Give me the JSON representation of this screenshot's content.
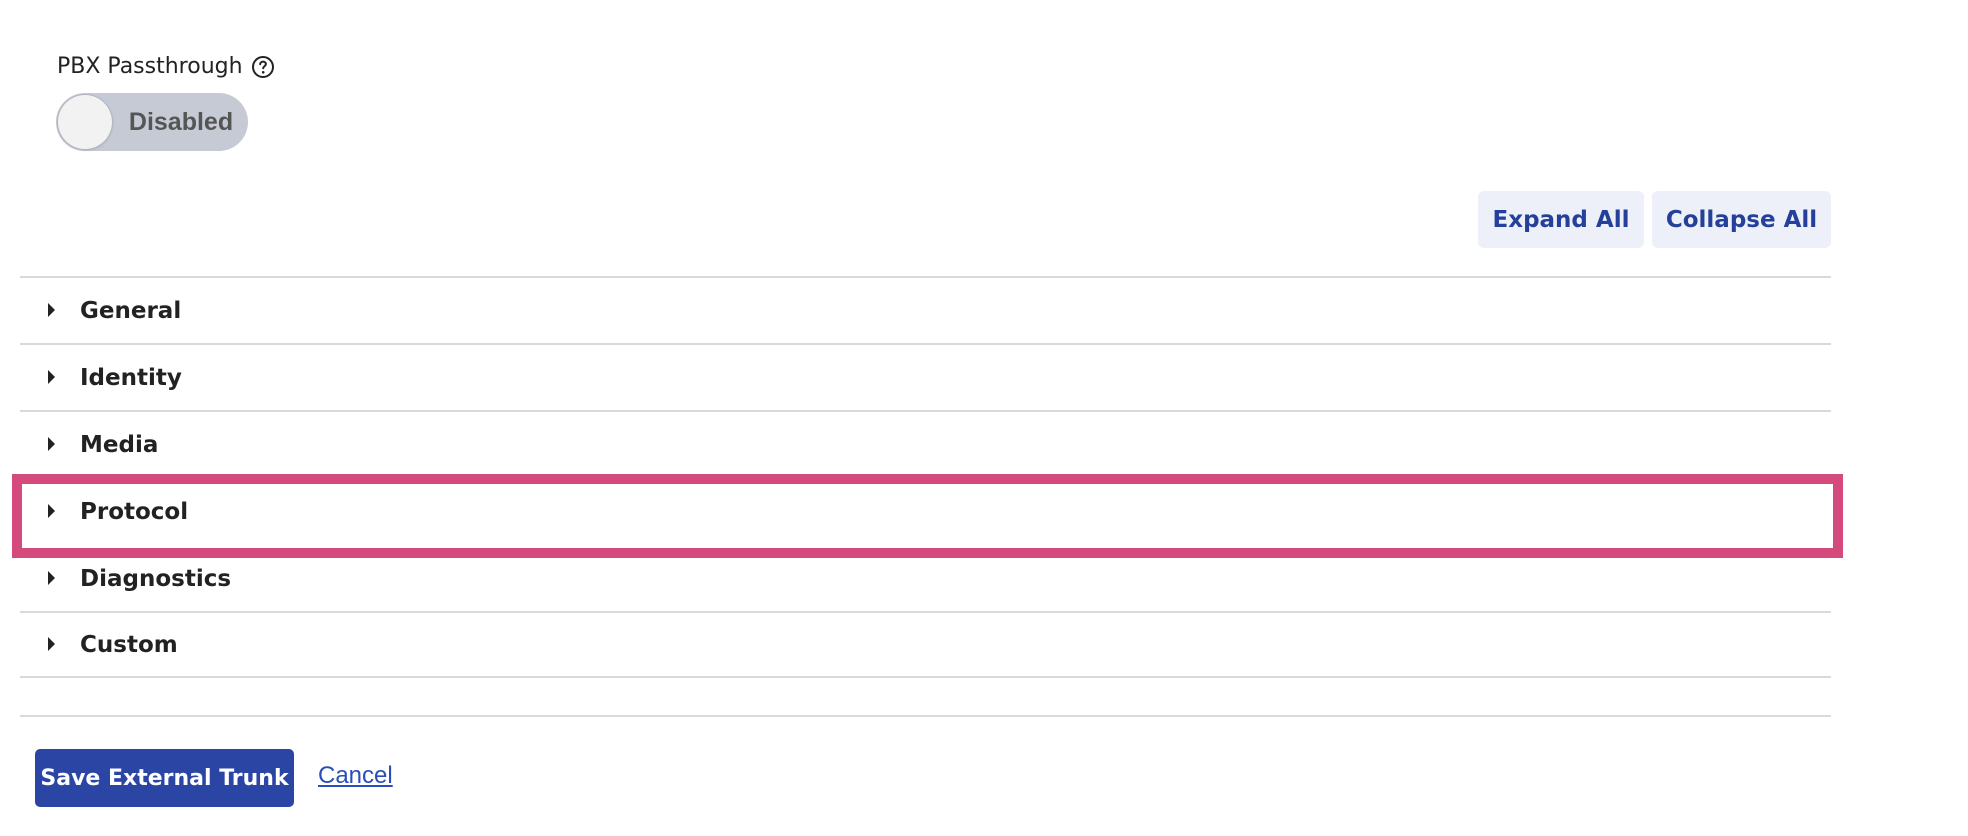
{
  "pbx": {
    "label": "PBX Passthrough",
    "help_icon": "question-circle-icon",
    "toggle_state": "Disabled"
  },
  "toolbar": {
    "expand_all": "Expand All",
    "collapse_all": "Collapse All"
  },
  "sections": [
    {
      "label": "General",
      "icon": "caret-right-icon"
    },
    {
      "label": "Identity",
      "icon": "caret-right-icon"
    },
    {
      "label": "Media",
      "icon": "caret-right-icon"
    },
    {
      "label": "Protocol",
      "icon": "caret-right-icon",
      "highlighted": true
    },
    {
      "label": "Diagnostics",
      "icon": "caret-right-icon"
    },
    {
      "label": "Custom",
      "icon": "caret-right-icon"
    }
  ],
  "footer": {
    "save_label": "Save External Trunk",
    "cancel_label": "Cancel"
  },
  "colors": {
    "primary": "#2b45a4",
    "highlight": "#d44a7c",
    "light_button_bg": "#edf0f8",
    "toggle_bg": "#c5cad4"
  }
}
